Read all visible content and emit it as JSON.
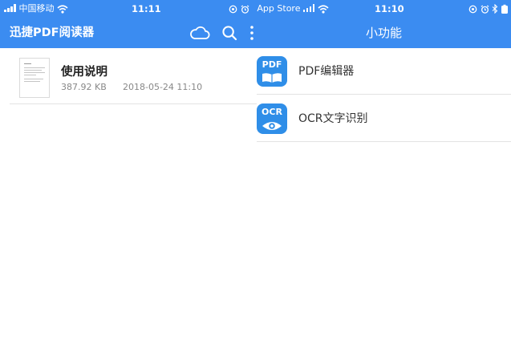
{
  "left_screen": {
    "status_bar": {
      "carrier": "中国移动",
      "time": "11:11"
    },
    "app_bar": {
      "title": "迅捷PDF阅读器",
      "icons": [
        "cloud-icon",
        "search-icon",
        "more-vertical-icon"
      ]
    },
    "files": [
      {
        "name": "使用说明",
        "size": "387.92 KB",
        "modified": "2018-05-24 11:10"
      }
    ]
  },
  "right_screen": {
    "status_bar": {
      "back_app": "App Store",
      "time": "11:10"
    },
    "app_bar": {
      "title": "小功能"
    },
    "tools": [
      {
        "icon_text": "PDF",
        "label": "PDF编辑器"
      },
      {
        "icon_text": "OCR",
        "label": "OCR文字识别"
      }
    ]
  },
  "colors": {
    "accent": "#3b8cf1",
    "icon_blue": "#2f8ee8",
    "divider": "#e3e3e3"
  }
}
